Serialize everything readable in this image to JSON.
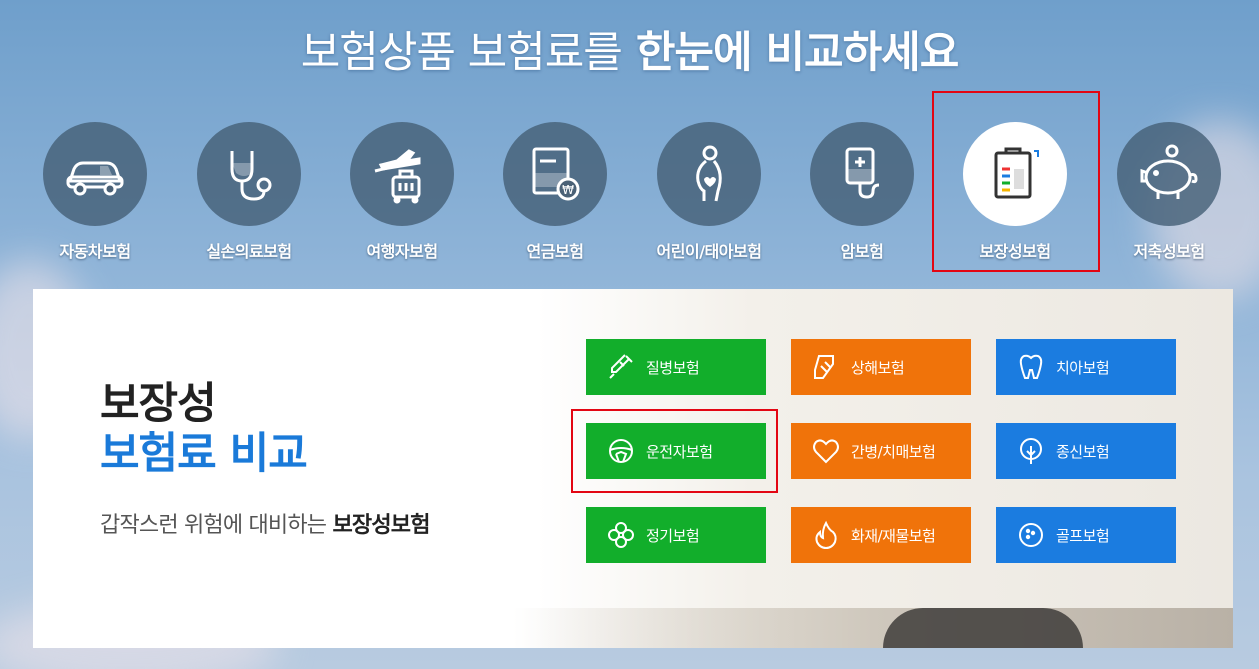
{
  "headline": {
    "light": "보험상품 보험료를",
    "bold": "한눈에 비교하세요"
  },
  "categories": [
    {
      "label": "자동차보험",
      "icon": "car-icon"
    },
    {
      "label": "실손의료보험",
      "icon": "stethoscope-icon"
    },
    {
      "label": "여행자보험",
      "icon": "travel-icon"
    },
    {
      "label": "연금보험",
      "icon": "pension-icon"
    },
    {
      "label": "어린이/태아보험",
      "icon": "pregnant-icon"
    },
    {
      "label": "암보험",
      "icon": "iv-bag-icon"
    },
    {
      "label": "보장성보험",
      "icon": "clipboard-icon",
      "active": true
    },
    {
      "label": "저축성보험",
      "icon": "piggy-bank-icon"
    }
  ],
  "panel": {
    "title_line1": "보장성",
    "title_line2": "보험료 비교",
    "subtitle_prefix": "갑작스런 위험에 대비하는",
    "subtitle_bold": "보장성보험"
  },
  "buttons": [
    {
      "label": "질병보험",
      "icon": "syringe-icon",
      "color": "#12ae2b"
    },
    {
      "label": "상해보험",
      "icon": "bandage-icon",
      "color": "#f0730a"
    },
    {
      "label": "치아보험",
      "icon": "tooth-icon",
      "color": "#1b7ce0"
    },
    {
      "label": "운전자보험",
      "icon": "steering-wheel-icon",
      "color": "#12ae2b"
    },
    {
      "label": "간병/치매보험",
      "icon": "heart-icon",
      "color": "#f0730a"
    },
    {
      "label": "종신보험",
      "icon": "tree-icon",
      "color": "#1b7ce0"
    },
    {
      "label": "정기보험",
      "icon": "clover-icon",
      "color": "#12ae2b"
    },
    {
      "label": "화재/재물보험",
      "icon": "flame-icon",
      "color": "#f0730a"
    },
    {
      "label": "골프보험",
      "icon": "golf-ball-icon",
      "color": "#1b7ce0"
    }
  ],
  "colors": {
    "highlight": "#e30613",
    "accent_blue": "#1a7ad9"
  }
}
